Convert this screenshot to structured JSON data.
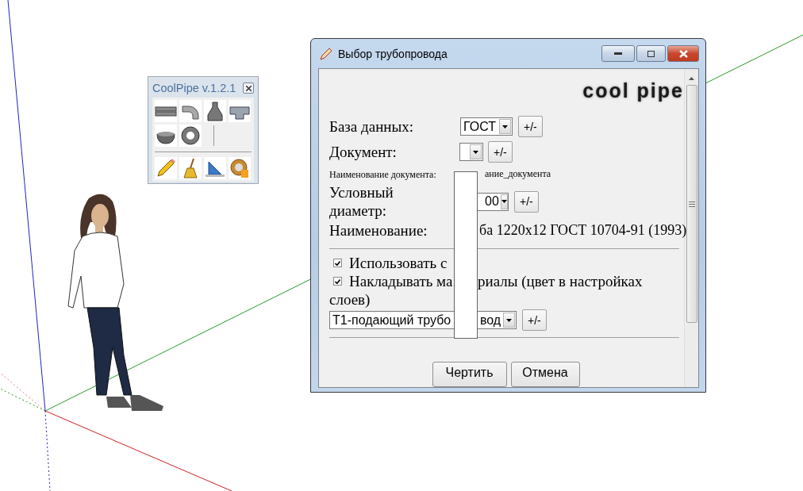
{
  "toolbar": {
    "title": "CoolPipe v.1.2.1"
  },
  "dialog": {
    "title": "Выбор трубопровода",
    "logo": "cool pipe",
    "database": {
      "label": "База данных:",
      "value": "ГОСТ",
      "button": "+/-"
    },
    "document": {
      "label": "Документ:",
      "button": "+/-",
      "open": true
    },
    "document_name": {
      "label": "Наименование документа:",
      "value": "ание_документа"
    },
    "diameter": {
      "label": "Условный диаметр:",
      "value": "00",
      "button": "+/-"
    },
    "name": {
      "label": "Наименование:",
      "value": "ба 1220x12 ГОСТ 10704-91 (1993)"
    },
    "checkboxes": [
      {
        "text_parts": [
          "Использовать с"
        ],
        "checked": true
      },
      {
        "text_parts": [
          "Накладывать ма",
          "риалы (цвет в настройках",
          "слоев)"
        ],
        "checked": true
      }
    ],
    "layer": {
      "value_parts": [
        "Т1-подающий трубо",
        "вод"
      ],
      "button": "+/-"
    },
    "buttons": [
      "Чертить",
      "Отмена"
    ]
  }
}
